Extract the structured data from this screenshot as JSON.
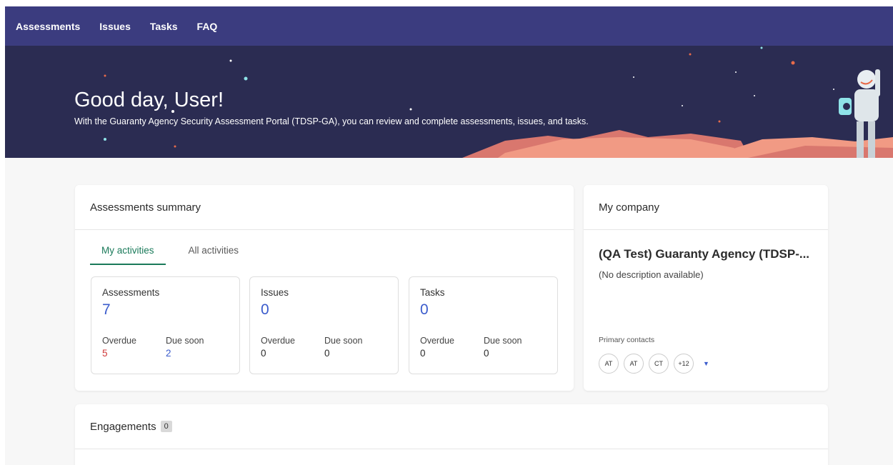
{
  "nav": {
    "items": [
      {
        "label": "Assessments"
      },
      {
        "label": "Issues"
      },
      {
        "label": "Tasks"
      },
      {
        "label": "FAQ"
      }
    ]
  },
  "hero": {
    "title": "Good day, User!",
    "subtitle": "With the Guaranty Agency Security Assessment Portal (TDSP-GA), you can review and complete assessments, issues, and tasks."
  },
  "assessments_summary": {
    "title": "Assessments summary",
    "tabs": [
      {
        "label": "My activities",
        "active": true
      },
      {
        "label": "All activities",
        "active": false
      }
    ],
    "stats": [
      {
        "title": "Assessments",
        "count": "7",
        "overdue_label": "Overdue",
        "overdue": "5",
        "due_soon_label": "Due soon",
        "due_soon": "2"
      },
      {
        "title": "Issues",
        "count": "0",
        "overdue_label": "Overdue",
        "overdue": "0",
        "due_soon_label": "Due soon",
        "due_soon": "0"
      },
      {
        "title": "Tasks",
        "count": "0",
        "overdue_label": "Overdue",
        "overdue": "0",
        "due_soon_label": "Due soon",
        "due_soon": "0"
      }
    ]
  },
  "company": {
    "title": "My company",
    "name": "(QA Test) Guaranty Agency (TDSP-...",
    "description": "(No description available)",
    "contacts_label": "Primary contacts",
    "contacts": [
      "AT",
      "AT",
      "CT",
      "+12"
    ]
  },
  "engagements": {
    "title": "Engagements",
    "count": "0"
  },
  "colors": {
    "nav": "#3b3c7f",
    "hero": "#2b2c52",
    "accent_green": "#1a7a5a",
    "link_blue": "#3b5ccc",
    "overdue_red": "#d0393a"
  }
}
